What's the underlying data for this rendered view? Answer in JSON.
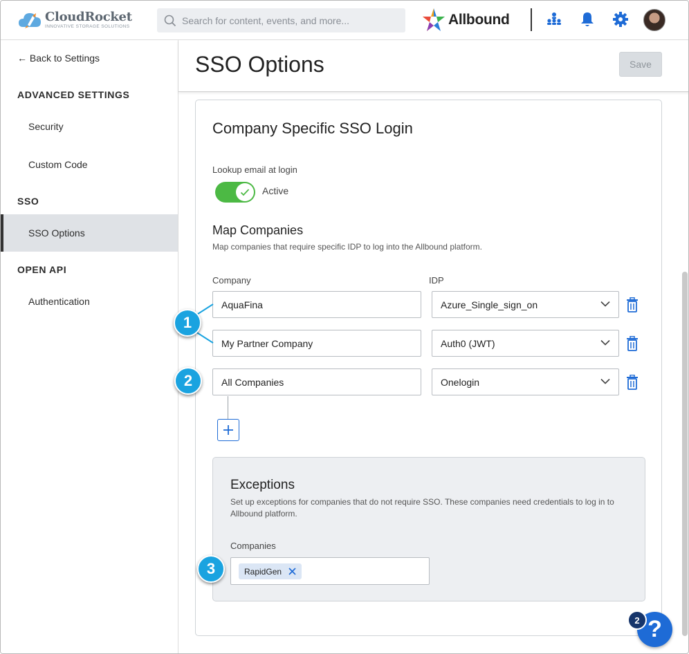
{
  "header": {
    "logo_name": "CloudRocket",
    "logo_tagline": "INNOVATIVE STORAGE SOLUTIONS",
    "search_placeholder": "Search for content, events, and more...",
    "brand": "Allbound",
    "icons": [
      "org-chart-icon",
      "bell-icon",
      "gear-icon",
      "avatar"
    ]
  },
  "sidebar": {
    "back_label": "Back to Settings",
    "sections": [
      {
        "title": "ADVANCED SETTINGS",
        "items": [
          "Security",
          "Custom Code"
        ]
      },
      {
        "title": "SSO",
        "items": [
          "SSO Options"
        ]
      },
      {
        "title": "OPEN API",
        "items": [
          "Authentication"
        ]
      }
    ],
    "active_item": "SSO Options"
  },
  "main": {
    "page_title": "SSO Options",
    "save_label": "Save",
    "card_title": "Company Specific SSO Login",
    "lookup_label": "Lookup email at login",
    "lookup_toggle": {
      "state": "Active",
      "on": true
    },
    "map_title": "Map Companies",
    "map_description": "Map companies that require specific IDP to log into the Allbound platform.",
    "company_label": "Company",
    "idp_label": "IDP",
    "mappings": [
      {
        "company": "AquaFina",
        "idp": "Azure_Single_sign_on"
      },
      {
        "company": "My Partner Company",
        "idp": "Auth0 (JWT)"
      },
      {
        "company": "All Companies",
        "idp": "Onelogin"
      }
    ],
    "exceptions": {
      "title": "Exceptions",
      "description": "Set up exceptions for companies that do not require SSO. These companies need credentials to log in to Allbound platform.",
      "companies_label": "Companies",
      "chips": [
        "RapidGen"
      ]
    }
  },
  "callouts": [
    "1",
    "2",
    "3"
  ],
  "help": {
    "count": "2",
    "label": "?"
  },
  "colors": {
    "accent": "#1e6bd6",
    "toggle_on": "#4cb944",
    "callout": "#1aa3e0",
    "sidebar_active": "#dfe2e6",
    "exceptions_bg": "#edeff2"
  }
}
